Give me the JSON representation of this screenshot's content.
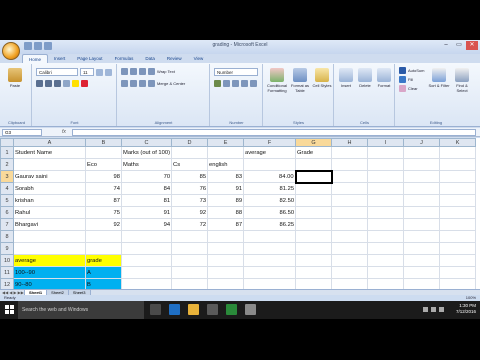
{
  "window": {
    "title": "grading - Microsoft Excel",
    "buttons": [
      "–",
      "▭",
      "✕"
    ]
  },
  "ribbon": {
    "tabs": [
      "Home",
      "Insert",
      "Page Layout",
      "Formulas",
      "Data",
      "Review",
      "View"
    ],
    "active_tab": "Home",
    "clipboard": {
      "paste": "Paste",
      "group": "Clipboard"
    },
    "font": {
      "name": "Calibri",
      "size": "11",
      "group": "Font"
    },
    "alignment": {
      "wrap": "Wrap Text",
      "merge": "Merge & Center",
      "group": "Alignment"
    },
    "number": {
      "format": "Number",
      "group": "Number"
    },
    "styles": {
      "conditional": "Conditional Formatting",
      "format_table": "Format as Table",
      "cell_styles": "Cell Styles",
      "group": "Styles"
    },
    "cells": {
      "insert": "Insert",
      "delete": "Delete",
      "format": "Format",
      "group": "Cells"
    },
    "editing": {
      "autosum": "AutoSum",
      "fill": "Fill",
      "clear": "Clear",
      "sort": "Sort & Filter",
      "find": "Find & Select",
      "group": "Editing"
    }
  },
  "formula_bar": {
    "cell_ref": "G3",
    "fx": "fx",
    "value": ""
  },
  "columns": [
    "A",
    "B",
    "C",
    "D",
    "E",
    "F",
    "G",
    "H",
    "I",
    "J",
    "K"
  ],
  "selected_column": "G",
  "selected_row": "3",
  "rows": [
    {
      "n": "1",
      "cells": {
        "A": "Student Name",
        "B": "",
        "C": "Marks (out of 100)",
        "D": "",
        "E": "",
        "F": "average",
        "G": "Grade"
      }
    },
    {
      "n": "2",
      "cells": {
        "A": "",
        "B": "Eco",
        "C": "Maths",
        "D": "Cs",
        "E": "english",
        "F": "",
        "G": ""
      }
    },
    {
      "n": "3",
      "cells": {
        "A": "Gaurav saini",
        "B": "98",
        "C": "70",
        "D": "85",
        "E": "83",
        "F": "84.00",
        "G": ""
      }
    },
    {
      "n": "4",
      "cells": {
        "A": "Sorabh",
        "B": "74",
        "C": "84",
        "D": "76",
        "E": "91",
        "F": "81.25",
        "G": ""
      }
    },
    {
      "n": "5",
      "cells": {
        "A": "krishan",
        "B": "87",
        "C": "81",
        "D": "73",
        "E": "89",
        "F": "82.50",
        "G": ""
      }
    },
    {
      "n": "6",
      "cells": {
        "A": "Rahul",
        "B": "75",
        "C": "91",
        "D": "92",
        "E": "88",
        "F": "86.50",
        "G": ""
      }
    },
    {
      "n": "7",
      "cells": {
        "A": "Bhargavi",
        "B": "92",
        "C": "94",
        "D": "72",
        "E": "87",
        "F": "86.25",
        "G": ""
      }
    },
    {
      "n": "8",
      "cells": {}
    },
    {
      "n": "9",
      "cells": {}
    },
    {
      "n": "10",
      "cells": {
        "A": "average",
        "B": "grade"
      }
    },
    {
      "n": "11",
      "cells": {
        "A": "100--90",
        "B": "A"
      }
    },
    {
      "n": "12",
      "cells": {
        "A": "90--80",
        "B": "B"
      }
    },
    {
      "n": "13",
      "cells": {
        "A": "80--70",
        "B": "C"
      }
    },
    {
      "n": "14",
      "cells": {
        "A": "70--60",
        "B": "D"
      }
    },
    {
      "n": "15",
      "cells": {
        "A": ">=60",
        "B": "F"
      }
    },
    {
      "n": "16",
      "cells": {}
    }
  ],
  "fills": {
    "yellow_rows": [
      "10"
    ],
    "blue_rows": [
      "11",
      "12",
      "13",
      "14",
      "15"
    ],
    "yellow": "#ffff00",
    "blue": "#00b0f0"
  },
  "sheet_tabs": [
    "Sheet1",
    "Sheet2",
    "Sheet3"
  ],
  "active_sheet": "Sheet1",
  "status": {
    "ready": "Ready",
    "zoom": "100%"
  },
  "taskbar": {
    "search_placeholder": "Search the web and Windows",
    "time": "1:30 PM",
    "date": "7/12/2016"
  }
}
